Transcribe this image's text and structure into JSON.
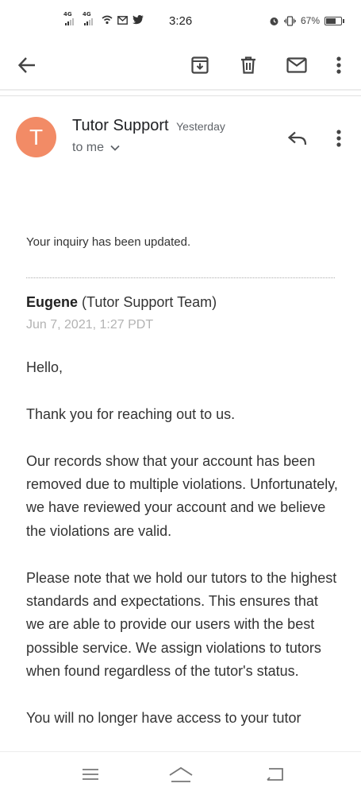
{
  "status_bar": {
    "net1": "4G",
    "net2": "4G",
    "time": "3:26",
    "battery": "67%",
    "battery_level": 0.67
  },
  "toolbar": {
    "icons": [
      "back-arrow-icon",
      "archive-icon",
      "delete-icon",
      "mark-unread-icon",
      "more-vert-icon"
    ]
  },
  "message": {
    "avatar_letter": "T",
    "avatar_color": "#f28b66",
    "sender": "Tutor Support",
    "time": "Yesterday",
    "recipient": "to me"
  },
  "email": {
    "notice": "Your inquiry has been updated.",
    "author_name": "Eugene",
    "author_team": "(Tutor Support Team)",
    "date": "Jun 7, 2021, 1:27 PDT",
    "paragraphs": [
      "Hello,",
      "Thank you for reaching out to us.",
      "Our records show that your account has been removed due to multiple violations. Unfortunately, we have reviewed your account and we believe the violations are valid.",
      "Please note that we hold our tutors to the highest standards and expectations. This ensures that we are able to provide our users with the best possible service. We assign violations to tutors when found regardless of the tutor's status.",
      "You will no longer have access to your tutor"
    ]
  }
}
